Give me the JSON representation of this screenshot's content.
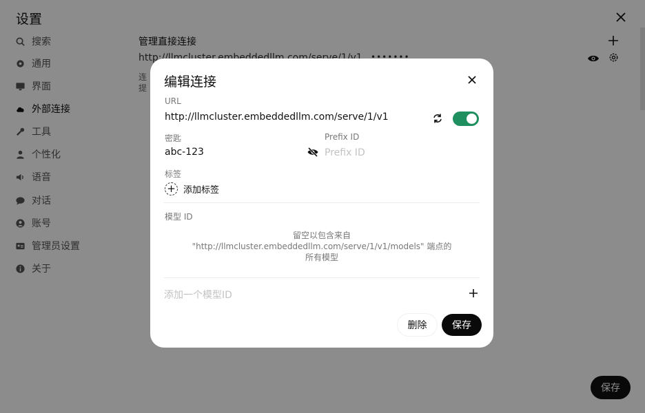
{
  "settings": {
    "title": "设置",
    "sidebar": [
      {
        "label": "搜索",
        "icon": "search-icon"
      },
      {
        "label": "通用",
        "icon": "gear-icon"
      },
      {
        "label": "界面",
        "icon": "monitor-icon"
      },
      {
        "label": "外部连接",
        "icon": "cloud-icon",
        "active": true
      },
      {
        "label": "工具",
        "icon": "wrench-icon"
      },
      {
        "label": "个性化",
        "icon": "user-icon"
      },
      {
        "label": "语音",
        "icon": "speaker-icon"
      },
      {
        "label": "对话",
        "icon": "chat-icon"
      },
      {
        "label": "账号",
        "icon": "account-icon"
      },
      {
        "label": "管理员设置",
        "icon": "admin-card-icon"
      },
      {
        "label": "关于",
        "icon": "info-icon"
      }
    ],
    "main": {
      "heading": "管理直接连接",
      "url": "http://llmcluster.embeddedllm.com/serve/1/v1",
      "masked_key": "•••••••",
      "desc_line1": "连",
      "desc_line2": "提",
      "save_label": "保存"
    }
  },
  "modal": {
    "title": "编辑连接",
    "url_label": "URL",
    "url_value": "http://llmcluster.embeddedllm.com/serve/1/v1",
    "enabled": true,
    "key_label": "密匙",
    "key_value": "abc-123",
    "prefix_label": "Prefix ID",
    "prefix_placeholder": "Prefix ID",
    "tags_label": "标签",
    "add_tag_label": "添加标签",
    "model_id_label": "模型 ID",
    "hint_line1": "留空以包含来自",
    "hint_line2": "\"http://llmcluster.embeddedllm.com/serve/1/v1/models\" 端点的",
    "hint_line3": "所有模型",
    "model_placeholder": "添加一个模型ID",
    "delete_label": "删除",
    "save_label": "保存"
  },
  "colors": {
    "toggle_on": "#1f8f5f",
    "primary_button": "#0a0a0a"
  }
}
